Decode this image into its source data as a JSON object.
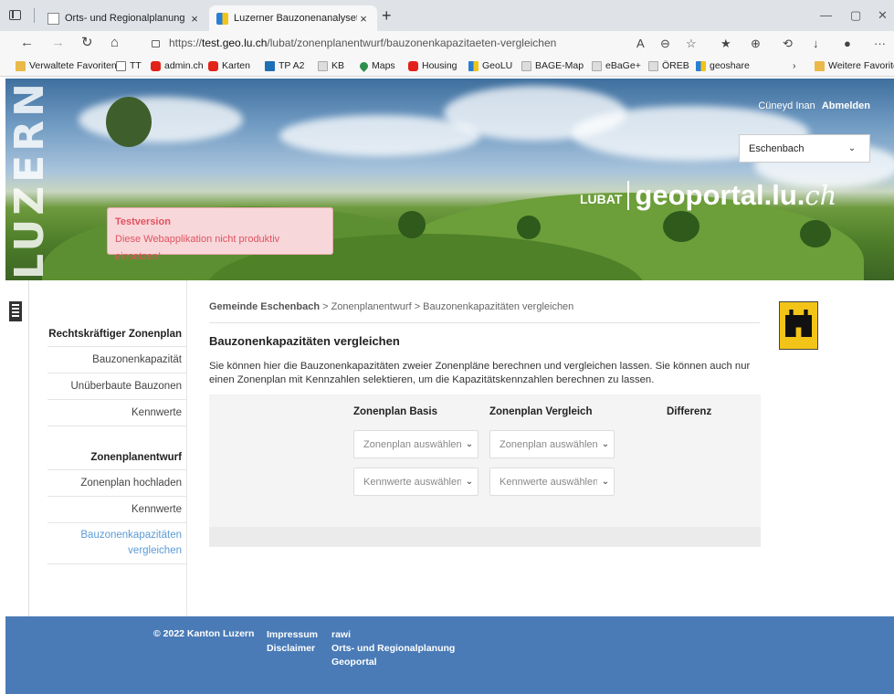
{
  "browser": {
    "tabs": [
      {
        "label": "Orts- und Regionalplanung (TES",
        "active": false
      },
      {
        "label": "Luzerner Bauzonenanalysetool (",
        "active": true
      }
    ],
    "url_prefix": "https://",
    "url_host": "test.geo.lu.ch",
    "url_path": "/lubat/zonenplanentwurf/bauzonenkapazitaeten-vergleichen",
    "favorites": [
      "Verwaltete Favoriten",
      "TT",
      "admin.ch",
      "Karten",
      "TP A2",
      "KB",
      "Maps",
      "Housing",
      "GeoLU",
      "BAGE-Map",
      "eBaGe+",
      "ÖREB",
      "geoshare",
      "Weitere Favoriten"
    ]
  },
  "header": {
    "logo_text": "LUZERN",
    "user_name": "Cüneyd Inan",
    "logout_label": "Abmelden",
    "gemeinde_selected": "Eschenbach",
    "brand_lubat": "LUBAT",
    "brand_geo": "geoportal.lu.",
    "brand_ch": "ch",
    "test_title": "Testversion",
    "test_message": "Diese Webapplikation nicht produktiv einsetzen!"
  },
  "sidebar": {
    "section1": "Rechtskräftiger Zonenplan",
    "section1_items": [
      "Bauzonenkapazität",
      "Unüberbaute Bauzonen",
      "Kennwerte"
    ],
    "section2": "Zonenplanentwurf",
    "section2_items": [
      "Zonenplan hochladen",
      "Kennwerte"
    ],
    "active_item_line1": "Bauzonenkapazitäten",
    "active_item_line2": "vergleichen"
  },
  "main": {
    "breadcrumb_gemeinde": "Gemeinde Eschenbach",
    "breadcrumb_rest": " > Zonenplanentwurf > Bauzonenkapazitäten vergleichen",
    "title": "Bauzonenkapazitäten vergleichen",
    "description": "Sie können hier die Bauzonenkapazitäten zweier Zonenpläne berechnen und vergleichen lassen. Sie können auch nur einen Zonenplan mit Kennzahlen selektieren, um die Kapazitätskennzahlen berechnen zu lassen.",
    "col_basis": "Zonenplan Basis",
    "col_vergleich": "Zonenplan Vergleich",
    "col_differenz": "Differenz",
    "zonenplan_placeholder": "Zonenplan auswählen",
    "kennwerte_placeholder": "Kennwerte auswählen"
  },
  "footer": {
    "copyright": "© 2022 Kanton Luzern",
    "links_col1": [
      "Impressum",
      "Disclaimer"
    ],
    "links_col2": [
      "rawi",
      "Orts- und Regionalplanung",
      "Geoportal"
    ]
  }
}
